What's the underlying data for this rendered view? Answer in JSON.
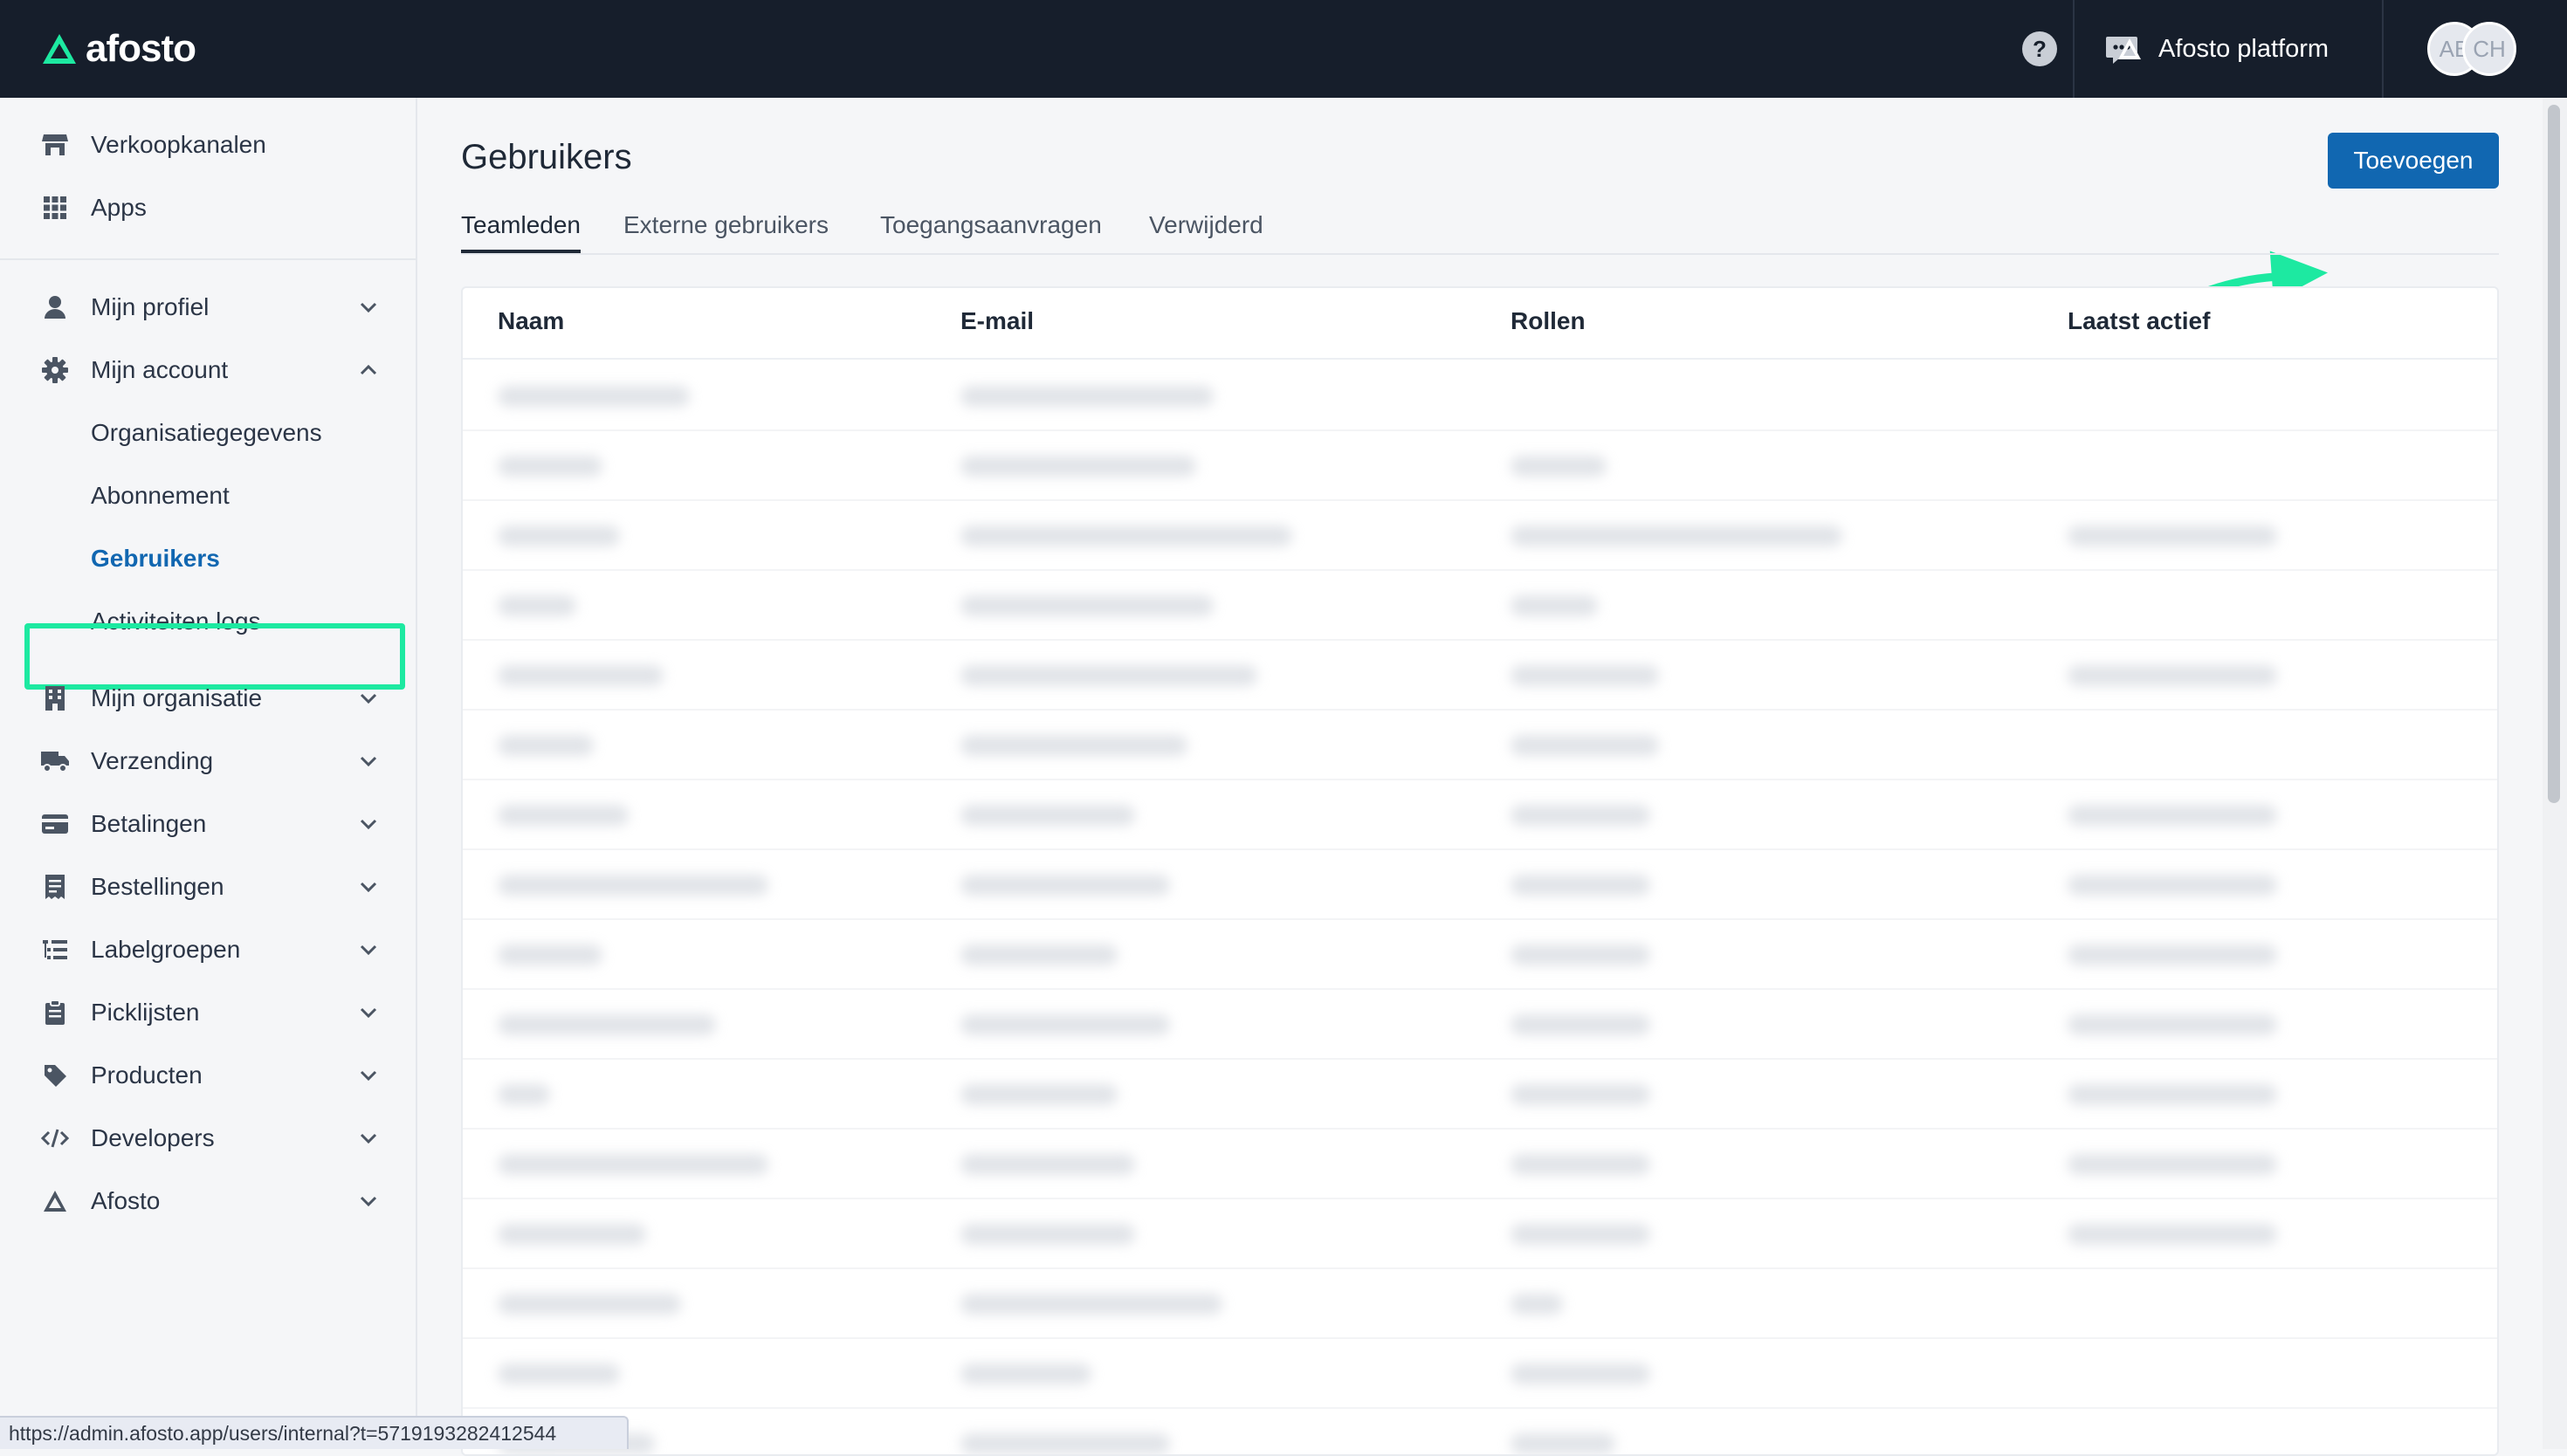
{
  "header": {
    "logo_text": "afosto",
    "help_icon": "help-circle-icon",
    "chat_icon": "chat-bubble-icon",
    "platform_label": "Afosto platform",
    "avatars": [
      "AB",
      "CH"
    ]
  },
  "sidebar": {
    "top_items": [
      {
        "label": "Verkoopkanalen",
        "icon": "store-icon"
      },
      {
        "label": "Apps",
        "icon": "grid-icon"
      }
    ],
    "sections": [
      {
        "label": "Mijn profiel",
        "icon": "user-icon",
        "expanded": false
      },
      {
        "label": "Mijn account",
        "icon": "gear-icon",
        "expanded": true,
        "children": [
          "Organisatiegegevens",
          "Abonnement",
          "Gebruikers",
          "Activiteiten logs"
        ]
      },
      {
        "label": "Mijn organisatie",
        "icon": "building-icon",
        "expanded": false
      },
      {
        "label": "Verzending",
        "icon": "truck-icon",
        "expanded": false
      },
      {
        "label": "Betalingen",
        "icon": "credit-card-icon",
        "expanded": false
      },
      {
        "label": "Bestellingen",
        "icon": "receipt-icon",
        "expanded": false
      },
      {
        "label": "Labelgroepen",
        "icon": "list-tree-icon",
        "expanded": false
      },
      {
        "label": "Picklijsten",
        "icon": "clipboard-icon",
        "expanded": false
      },
      {
        "label": "Producten",
        "icon": "tag-icon",
        "expanded": false
      },
      {
        "label": "Developers",
        "icon": "code-icon",
        "expanded": false
      },
      {
        "label": "Afosto",
        "icon": "afosto-logo-icon",
        "expanded": false
      }
    ],
    "active_item": "Gebruikers"
  },
  "main": {
    "title": "Gebruikers",
    "tabs": [
      "Teamleden",
      "Externe gebruikers",
      "Toegangsaanvragen",
      "Verwijderd"
    ],
    "active_tab": "Teamleden",
    "add_button_label": "Toevoegen",
    "table": {
      "columns": [
        "Naam",
        "E-mail",
        "Rollen",
        "Laatst actief"
      ]
    }
  },
  "status_bar": {
    "url": "https://admin.afosto.app/users/internal?t=5719193282412544"
  },
  "colors": {
    "topbar": "#161e2b",
    "accent": "#1167b1",
    "highlight": "#1de9a1"
  }
}
